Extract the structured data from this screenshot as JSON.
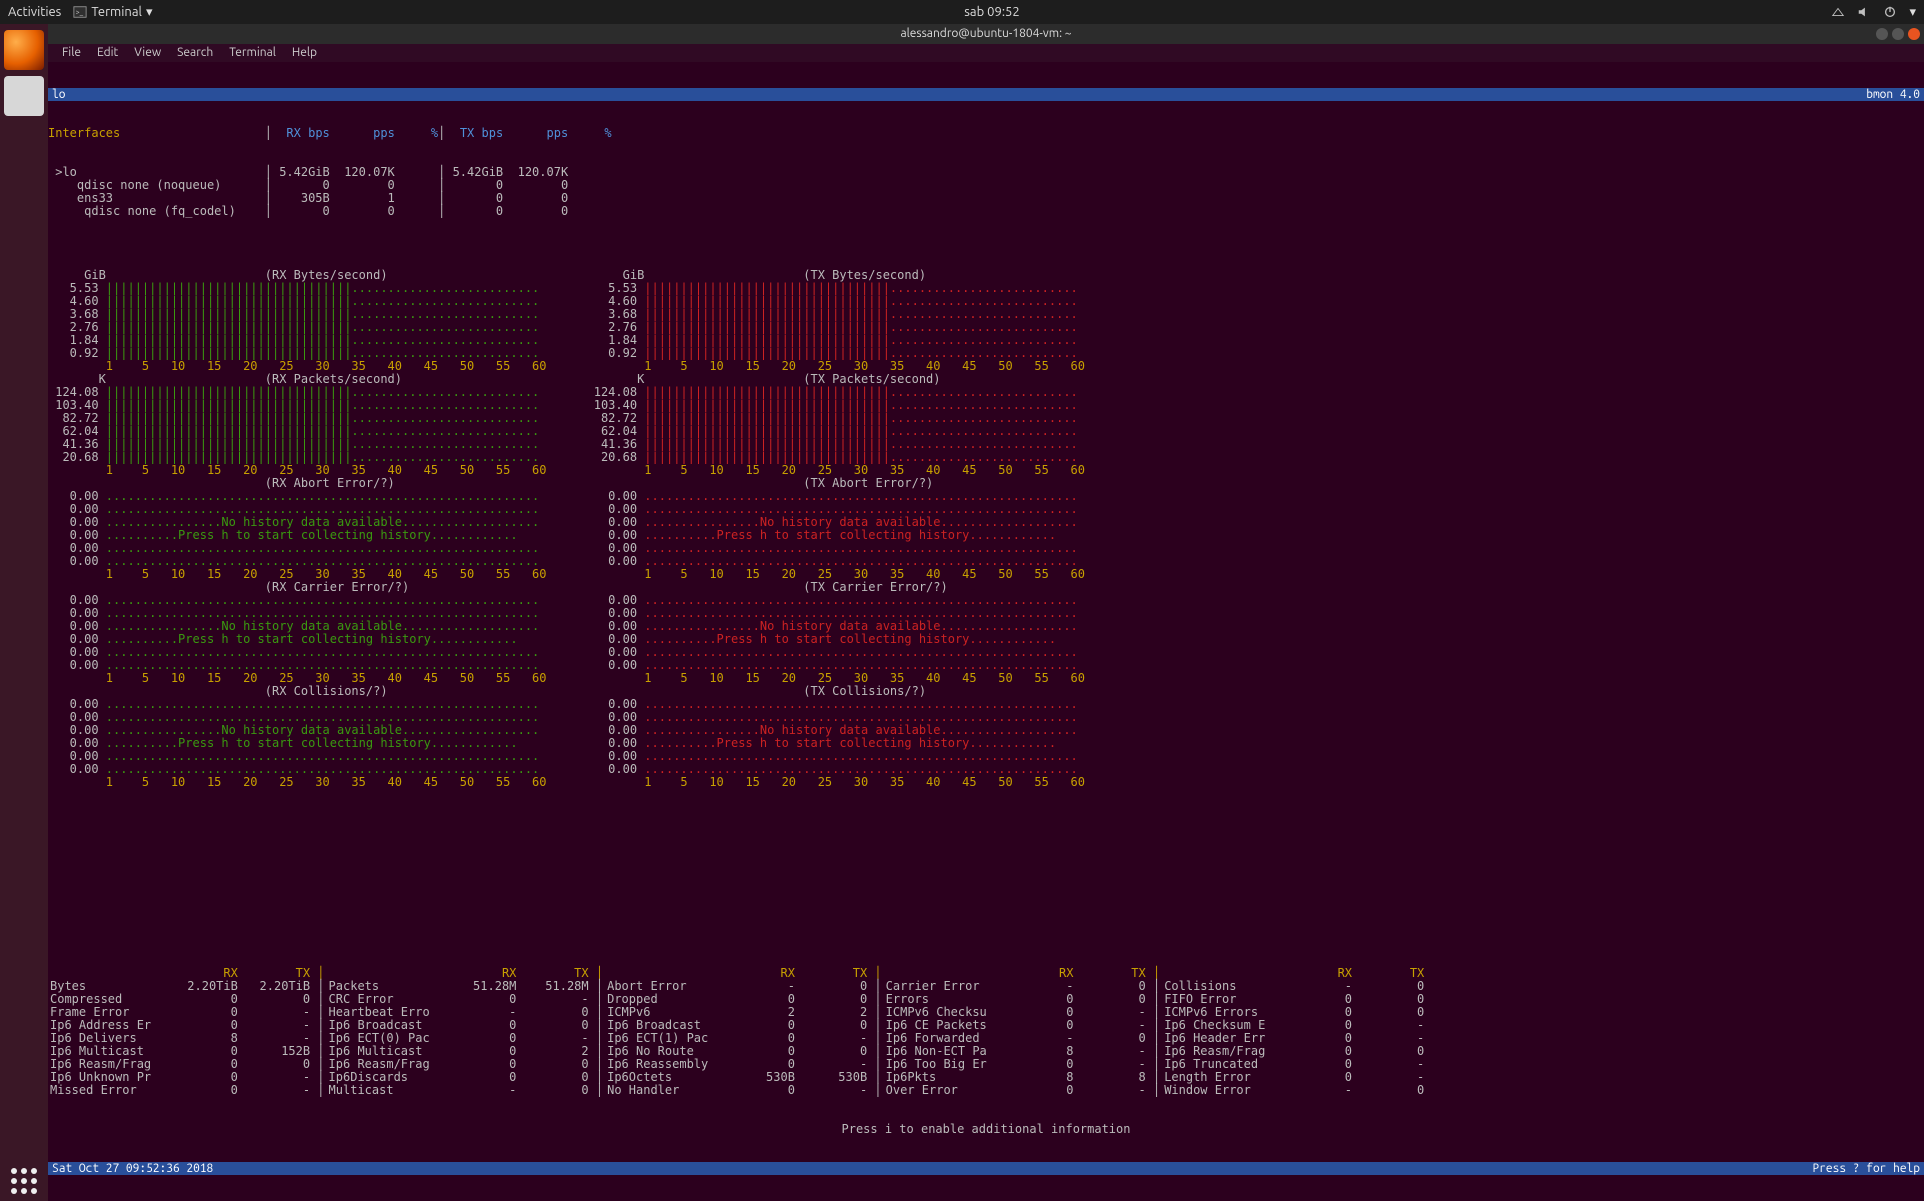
{
  "topbar": {
    "activities": "Activities",
    "app": "Terminal",
    "clock": "sab 09:52"
  },
  "window": {
    "title": "alessandro@ubuntu-1804-vm: ~"
  },
  "menubar": [
    "File",
    "Edit",
    "View",
    "Search",
    "Terminal",
    "Help"
  ],
  "bmon": {
    "selected": "lo",
    "version": "bmon 4.0",
    "header_if": "Interfaces",
    "cols": [
      "RX bps",
      "pps",
      "%",
      "TX bps",
      "pps",
      "%"
    ],
    "rows": [
      {
        "name": "lo",
        "sel": true,
        "rx_bps": "5.42GiB",
        "rx_pps": "120.07K",
        "rx_pct": "",
        "tx_bps": "5.42GiB",
        "tx_pps": "120.07K",
        "tx_pct": ""
      },
      {
        "name": "  qdisc none (noqueue)",
        "rx_bps": "0",
        "rx_pps": "0",
        "rx_pct": "",
        "tx_bps": "0",
        "tx_pps": "0",
        "tx_pct": ""
      },
      {
        "name": "  ens33",
        "rx_bps": "305B",
        "rx_pps": "1",
        "rx_pct": "",
        "tx_bps": "0",
        "tx_pps": "0",
        "tx_pct": ""
      },
      {
        "name": "   qdisc none (fq_codel)",
        "rx_bps": "0",
        "rx_pps": "0",
        "rx_pct": "",
        "tx_bps": "0",
        "tx_pps": "0",
        "tx_pct": ""
      }
    ],
    "x_axis": "  1    5   10   15   20   25   30   35   40   45   50   55   60",
    "bytes": {
      "unit": "GiB",
      "yticks": [
        "5.53",
        "4.60",
        "3.68",
        "2.76",
        "1.84",
        "0.92"
      ],
      "bars": [
        34,
        34,
        34,
        34,
        34,
        34
      ]
    },
    "packets": {
      "unit": "K",
      "yticks": [
        "124.08",
        "103.40",
        "82.72",
        "62.04",
        "41.36",
        "20.68"
      ],
      "bars": [
        34,
        34,
        34,
        34,
        34,
        34
      ]
    },
    "empty_yticks": [
      "0.00",
      "0.00",
      "0.00",
      "0.00",
      "0.00",
      "0.00"
    ],
    "nohist1": "No history data available.",
    "nohist2": "Press h to start collecting history.",
    "sections_rx": [
      "(RX Bytes/second)",
      "(RX Packets/second)",
      "(RX Abort Error/?)",
      "(RX Carrier Error/?)",
      "(RX Collisions/?)"
    ],
    "sections_tx": [
      "(TX Bytes/second)",
      "(TX Packets/second)",
      "(TX Abort Error/?)",
      "(TX Carrier Error/?)",
      "(TX Collisions/?)"
    ],
    "stats_hint": "Press i to enable additional information",
    "statusbar": {
      "time": "Sat Oct 27 09:52:36 2018",
      "help": "Press ? for help"
    },
    "stats_header": {
      "rx": "RX",
      "tx": "TX"
    },
    "stats": [
      [
        {
          "n": "Bytes",
          "rx": "2.20TiB",
          "tx": "2.20TiB"
        },
        {
          "n": "Compressed",
          "rx": "0",
          "tx": "0"
        },
        {
          "n": "Frame Error",
          "rx": "0",
          "tx": "-"
        },
        {
          "n": "Ip6 Address Er",
          "rx": "0",
          "tx": "-"
        },
        {
          "n": "Ip6 Delivers",
          "rx": "8",
          "tx": "-"
        },
        {
          "n": "Ip6 Multicast",
          "rx": "0",
          "tx": "152B"
        },
        {
          "n": "Ip6 Reasm/Frag",
          "rx": "0",
          "tx": "0"
        },
        {
          "n": "Ip6 Unknown Pr",
          "rx": "0",
          "tx": "-"
        },
        {
          "n": "Missed Error",
          "rx": "0",
          "tx": "-"
        }
      ],
      [
        {
          "n": "Packets",
          "rx": "51.28M",
          "tx": "51.28M"
        },
        {
          "n": "CRC Error",
          "rx": "0",
          "tx": "-"
        },
        {
          "n": "Heartbeat Erro",
          "rx": "-",
          "tx": "0"
        },
        {
          "n": "Ip6 Broadcast",
          "rx": "0",
          "tx": "0"
        },
        {
          "n": "Ip6 ECT(0) Pac",
          "rx": "0",
          "tx": "-"
        },
        {
          "n": "Ip6 Multicast",
          "rx": "0",
          "tx": "2"
        },
        {
          "n": "Ip6 Reasm/Frag",
          "rx": "0",
          "tx": "0"
        },
        {
          "n": "Ip6Discards",
          "rx": "0",
          "tx": "0"
        },
        {
          "n": "Multicast",
          "rx": "-",
          "tx": "0"
        }
      ],
      [
        {
          "n": "Abort Error",
          "rx": "-",
          "tx": "0"
        },
        {
          "n": "Dropped",
          "rx": "0",
          "tx": "0"
        },
        {
          "n": "ICMPv6",
          "rx": "2",
          "tx": "2"
        },
        {
          "n": "Ip6 Broadcast",
          "rx": "0",
          "tx": "0"
        },
        {
          "n": "Ip6 ECT(1) Pac",
          "rx": "0",
          "tx": "-"
        },
        {
          "n": "Ip6 No Route",
          "rx": "0",
          "tx": "0"
        },
        {
          "n": "Ip6 Reassembly",
          "rx": "0",
          "tx": "-"
        },
        {
          "n": "Ip6Octets",
          "rx": "530B",
          "tx": "530B"
        },
        {
          "n": "No Handler",
          "rx": "0",
          "tx": "-"
        }
      ],
      [
        {
          "n": "Carrier Error",
          "rx": "-",
          "tx": "0"
        },
        {
          "n": "Errors",
          "rx": "0",
          "tx": "0"
        },
        {
          "n": "ICMPv6 Checksu",
          "rx": "0",
          "tx": "-"
        },
        {
          "n": "Ip6 CE Packets",
          "rx": "0",
          "tx": "-"
        },
        {
          "n": "Ip6 Forwarded",
          "rx": "-",
          "tx": "0"
        },
        {
          "n": "Ip6 Non-ECT Pa",
          "rx": "8",
          "tx": "-"
        },
        {
          "n": "Ip6 Too Big Er",
          "rx": "0",
          "tx": "-"
        },
        {
          "n": "Ip6Pkts",
          "rx": "8",
          "tx": "8"
        },
        {
          "n": "Over Error",
          "rx": "0",
          "tx": "-"
        }
      ],
      [
        {
          "n": "Collisions",
          "rx": "-",
          "tx": "0"
        },
        {
          "n": "FIFO Error",
          "rx": "0",
          "tx": "0"
        },
        {
          "n": "ICMPv6 Errors",
          "rx": "0",
          "tx": "0"
        },
        {
          "n": "Ip6 Checksum E",
          "rx": "0",
          "tx": "-"
        },
        {
          "n": "Ip6 Header Err",
          "rx": "0",
          "tx": "-"
        },
        {
          "n": "Ip6 Reasm/Frag",
          "rx": "0",
          "tx": "0"
        },
        {
          "n": "Ip6 Truncated",
          "rx": "0",
          "tx": "-"
        },
        {
          "n": "Length Error",
          "rx": "0",
          "tx": "-"
        },
        {
          "n": "Window Error",
          "rx": "-",
          "tx": "0"
        }
      ]
    ]
  },
  "chart_data": [
    {
      "type": "bar",
      "title": "(RX Bytes/second)",
      "categories_range": [
        1,
        60
      ],
      "yticks": [
        0.92,
        1.84,
        2.76,
        3.68,
        4.6,
        5.53
      ],
      "ylabel": "GiB",
      "series": [
        {
          "name": "RX Bytes/s",
          "values_note": "bars fill ~34/60 columns at near-max height"
        }
      ]
    },
    {
      "type": "bar",
      "title": "(TX Bytes/second)",
      "categories_range": [
        1,
        60
      ],
      "yticks": [
        0.92,
        1.84,
        2.76,
        3.68,
        4.6,
        5.53
      ],
      "ylabel": "GiB",
      "series": [
        {
          "name": "TX Bytes/s",
          "values_note": "bars fill ~34/60 columns at near-max height"
        }
      ]
    },
    {
      "type": "bar",
      "title": "(RX Packets/second)",
      "categories_range": [
        1,
        60
      ],
      "yticks": [
        20.68,
        41.36,
        62.04,
        82.72,
        103.4,
        124.08
      ],
      "ylabel": "K",
      "series": [
        {
          "name": "RX pkts/s",
          "values_note": "bars fill ~34/60 columns at near-max height"
        }
      ]
    },
    {
      "type": "bar",
      "title": "(TX Packets/second)",
      "categories_range": [
        1,
        60
      ],
      "yticks": [
        20.68,
        41.36,
        62.04,
        82.72,
        103.4,
        124.08
      ],
      "ylabel": "K",
      "series": [
        {
          "name": "TX pkts/s",
          "values_note": "bars fill ~34/60 columns at near-max height"
        }
      ]
    }
  ]
}
